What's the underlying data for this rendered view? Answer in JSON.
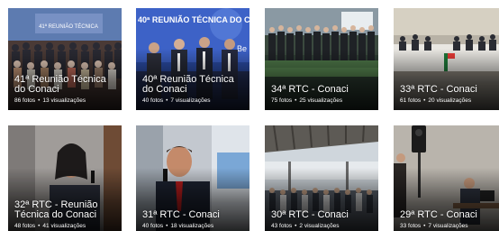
{
  "albums": [
    {
      "title": "41ª Reunião Técnica do Conaci",
      "photos": "86 fotos",
      "views": "13 visualizações"
    },
    {
      "title": "40ª Reunião Técnica do Conaci",
      "photos": "40 fotos",
      "views": "7 visualizações"
    },
    {
      "title": "34ª RTC - Conaci",
      "photos": "75 fotos",
      "views": "25 visualizações"
    },
    {
      "title": "33ª RTC - Conaci",
      "photos": "61 fotos",
      "views": "20 visualizações"
    },
    {
      "title": "32ª RTC - Reunião Técnica do Conaci",
      "photos": "48 fotos",
      "views": "41 visualizações"
    },
    {
      "title": "31ª RTC - Conaci",
      "photos": "40 fotos",
      "views": "18 visualizações"
    },
    {
      "title": "30ª RTC - Conaci",
      "photos": "43 fotos",
      "views": "2 visualizações"
    },
    {
      "title": "29ª RTC - Conaci",
      "photos": "33 fotos",
      "views": "7 visualizações"
    }
  ],
  "banner_text": {
    "card1": "41ª REUNIÃO TÉCNICA",
    "card2": "40ª REUNIÃO TÉCNICA DO CONACI",
    "card2_side": "Be"
  },
  "separator": "•"
}
